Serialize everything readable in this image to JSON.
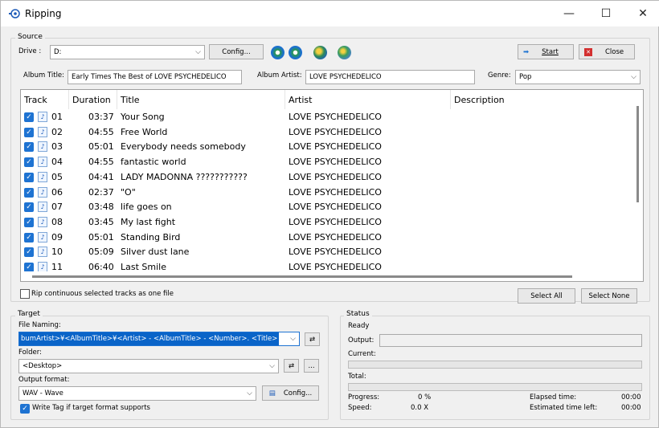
{
  "window": {
    "title": "Ripping",
    "minimize": "—",
    "maximize": "☐",
    "close": "✕"
  },
  "source": {
    "group_label": "Source",
    "drive_label": "Drive :",
    "drive_value": "D:",
    "config_button": "Config...",
    "start_button": "Start",
    "close_button": "Close",
    "album_title_label": "Album Title:",
    "album_title_value": "Early Times The Best of LOVE PSYCHEDELICO",
    "album_artist_label": "Album Artist:",
    "album_artist_value": "LOVE PSYCHEDELICO",
    "genre_label": "Genre:",
    "genre_value": "Pop"
  },
  "tracklist": {
    "columns": [
      "Track",
      "Duration",
      "Title",
      "Artist",
      "Description"
    ],
    "rows": [
      {
        "track": "01",
        "duration": "03:37",
        "title": "Your Song",
        "artist": "LOVE PSYCHEDELICO"
      },
      {
        "track": "02",
        "duration": "04:55",
        "title": "Free World",
        "artist": "LOVE PSYCHEDELICO"
      },
      {
        "track": "03",
        "duration": "05:01",
        "title": "Everybody needs somebody",
        "artist": "LOVE PSYCHEDELICO"
      },
      {
        "track": "04",
        "duration": "04:55",
        "title": "fantastic world",
        "artist": "LOVE PSYCHEDELICO"
      },
      {
        "track": "05",
        "duration": "04:41",
        "title": "LADY MADONNA ???????????",
        "artist": "LOVE PSYCHEDELICO"
      },
      {
        "track": "06",
        "duration": "02:37",
        "title": "\"O\"",
        "artist": "LOVE PSYCHEDELICO"
      },
      {
        "track": "07",
        "duration": "03:48",
        "title": "life goes on",
        "artist": "LOVE PSYCHEDELICO"
      },
      {
        "track": "08",
        "duration": "03:45",
        "title": "My last fight",
        "artist": "LOVE PSYCHEDELICO"
      },
      {
        "track": "09",
        "duration": "05:01",
        "title": "Standing Bird",
        "artist": "LOVE PSYCHEDELICO"
      },
      {
        "track": "10",
        "duration": "05:09",
        "title": "Silver dust lane",
        "artist": "LOVE PSYCHEDELICO"
      },
      {
        "track": "11",
        "duration": "06:40",
        "title": "Last Smile",
        "artist": "LOVE PSYCHEDELICO"
      }
    ],
    "rip_continuous_label": "Rip continuous selected tracks as one file",
    "select_all": "Select All",
    "select_none": "Select None"
  },
  "target": {
    "group_label": "Target",
    "file_naming_label": "File Naming:",
    "file_naming_value": "bumArtist>¥<AlbumTitle>¥<Artist> - <AlbumTitle> - <Number>. <Title>",
    "folder_label": "Folder:",
    "folder_value": "<Desktop>",
    "browse_button": "...",
    "output_format_label": "Output format:",
    "output_format_value": "WAV - Wave",
    "format_config_button": "Config...",
    "write_tag_label": "Write Tag if target format supports"
  },
  "status": {
    "group_label": "Status",
    "state": "Ready",
    "output_label": "Output:",
    "current_label": "Current:",
    "total_label": "Total:",
    "progress_label": "Progress:",
    "progress_value": "0 %",
    "speed_label": "Speed:",
    "speed_value": "0.0 X",
    "elapsed_label": "Elapsed time:",
    "elapsed_value": "00:00",
    "estimated_label": "Estimated time left:",
    "estimated_value": "00:00"
  },
  "colors": {
    "accent": "#1e73d2",
    "selection": "#0a64c8"
  }
}
